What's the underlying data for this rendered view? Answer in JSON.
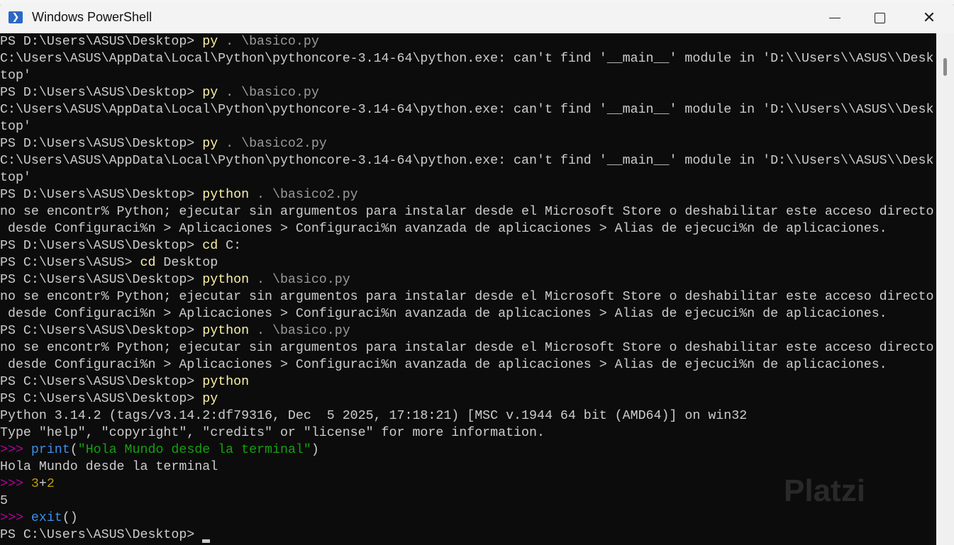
{
  "window": {
    "title": "Windows PowerShell",
    "icon": "powershell-icon"
  },
  "watermark": "Platzi",
  "terminal": {
    "lines": [
      [
        [
          "PS D:\\Users\\ASUS\\Desktop> ",
          ""
        ],
        [
          "py",
          "c-cmd"
        ],
        [
          " . \\basico.py",
          "c-dim"
        ]
      ],
      [
        [
          "C:\\Users\\ASUS\\AppData\\Local\\Python\\pythoncore-3.14-64\\python.exe: can't find '__main__' module in 'D:\\\\Users\\\\ASUS\\\\Desk",
          ""
        ]
      ],
      [
        [
          "top'",
          ""
        ]
      ],
      [
        [
          "PS D:\\Users\\ASUS\\Desktop> ",
          ""
        ],
        [
          "py",
          "c-cmd"
        ],
        [
          " . \\basico.py",
          "c-dim"
        ]
      ],
      [
        [
          "C:\\Users\\ASUS\\AppData\\Local\\Python\\pythoncore-3.14-64\\python.exe: can't find '__main__' module in 'D:\\\\Users\\\\ASUS\\\\Desk",
          ""
        ]
      ],
      [
        [
          "top'",
          ""
        ]
      ],
      [
        [
          "PS D:\\Users\\ASUS\\Desktop> ",
          ""
        ],
        [
          "py",
          "c-cmd"
        ],
        [
          " . \\basico2.py",
          "c-dim"
        ]
      ],
      [
        [
          "C:\\Users\\ASUS\\AppData\\Local\\Python\\pythoncore-3.14-64\\python.exe: can't find '__main__' module in 'D:\\\\Users\\\\ASUS\\\\Desk",
          ""
        ]
      ],
      [
        [
          "top'",
          ""
        ]
      ],
      [
        [
          "PS D:\\Users\\ASUS\\Desktop> ",
          ""
        ],
        [
          "python",
          "c-cmd"
        ],
        [
          " . \\basico2.py",
          "c-dim"
        ]
      ],
      [
        [
          "no se encontr% Python; ejecutar sin argumentos para instalar desde el Microsoft Store o deshabilitar este acceso directo",
          ""
        ]
      ],
      [
        [
          " desde Configuraci%n > Aplicaciones > Configuraci%n avanzada de aplicaciones > Alias de ejecuci%n de aplicaciones.",
          ""
        ]
      ],
      [
        [
          "PS D:\\Users\\ASUS\\Desktop> ",
          ""
        ],
        [
          "cd",
          "c-cmd"
        ],
        [
          " C:",
          ""
        ]
      ],
      [
        [
          "PS C:\\Users\\ASUS> ",
          ""
        ],
        [
          "cd",
          "c-cmd"
        ],
        [
          " Desktop",
          ""
        ]
      ],
      [
        [
          "PS C:\\Users\\ASUS\\Desktop> ",
          ""
        ],
        [
          "python",
          "c-cmd"
        ],
        [
          " . \\basico.py",
          "c-dim"
        ]
      ],
      [
        [
          "no se encontr% Python; ejecutar sin argumentos para instalar desde el Microsoft Store o deshabilitar este acceso directo",
          ""
        ]
      ],
      [
        [
          " desde Configuraci%n > Aplicaciones > Configuraci%n avanzada de aplicaciones > Alias de ejecuci%n de aplicaciones.",
          ""
        ]
      ],
      [
        [
          "PS C:\\Users\\ASUS\\Desktop> ",
          ""
        ],
        [
          "python",
          "c-cmd"
        ],
        [
          " . \\basico.py",
          "c-dim"
        ]
      ],
      [
        [
          "no se encontr% Python; ejecutar sin argumentos para instalar desde el Microsoft Store o deshabilitar este acceso directo",
          ""
        ]
      ],
      [
        [
          " desde Configuraci%n > Aplicaciones > Configuraci%n avanzada de aplicaciones > Alias de ejecuci%n de aplicaciones.",
          ""
        ]
      ],
      [
        [
          "PS C:\\Users\\ASUS\\Desktop> ",
          ""
        ],
        [
          "python",
          "c-cmd"
        ]
      ],
      [
        [
          "PS C:\\Users\\ASUS\\Desktop> ",
          ""
        ],
        [
          "py",
          "c-cmd"
        ]
      ],
      [
        [
          "Python 3.14.2 (tags/v3.14.2:df79316, Dec  5 2025, 17:18:21) [MSC v.1944 64 bit (AMD64)] on win32",
          ""
        ]
      ],
      [
        [
          "Type \"help\", \"copyright\", \"credits\" or \"license\" for more information.",
          ""
        ]
      ],
      [
        [
          ">>> ",
          "c-pr"
        ],
        [
          "print",
          "c-fn"
        ],
        [
          "(",
          ""
        ],
        [
          "\"Hola Mundo desde la terminal\"",
          "c-str"
        ],
        [
          ")",
          ""
        ]
      ],
      [
        [
          "Hola Mundo desde la terminal",
          ""
        ]
      ],
      [
        [
          ">>> ",
          "c-pr"
        ],
        [
          "3",
          "c-num"
        ],
        [
          "+",
          ""
        ],
        [
          "2",
          "c-num"
        ]
      ],
      [
        [
          "5",
          ""
        ]
      ],
      [
        [
          ">>> ",
          "c-pr"
        ],
        [
          "exit",
          "c-fn"
        ],
        [
          "()",
          ""
        ]
      ],
      [
        [
          "PS C:\\Users\\ASUS\\Desktop> ",
          ""
        ]
      ]
    ]
  }
}
